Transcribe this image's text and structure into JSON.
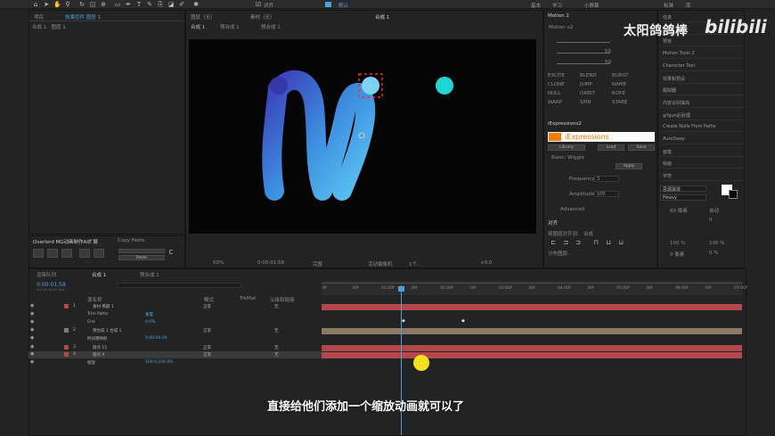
{
  "toolbar": {
    "snap_label": "对齐",
    "active_mode_label": "默认",
    "modes": [
      "基本",
      "学习",
      "小屏幕",
      "标准",
      "库"
    ]
  },
  "project_panel": {
    "tabs": [
      "项目",
      "效果控件 图层 1"
    ],
    "breadcrumb": "合成 1 · 图层 1"
  },
  "viewer": {
    "tabs": [
      "图层（无）",
      "素材（无）",
      "合成 1"
    ],
    "subtabs": [
      "合成 1",
      "预合成 1",
      "预合成 1"
    ],
    "zoom": "50%",
    "timecode": "0:00:01:58",
    "quality": "完整",
    "camera": "活动摄像机",
    "views": "1个...",
    "offset": "+0.0"
  },
  "right_panel": {
    "motion_title": "Motion 2",
    "motion_select": "Motion v2",
    "motion_values": [
      "50",
      "50"
    ],
    "motion_buttons": [
      "EXCITE",
      "BLEND",
      "BURST",
      "CLONE",
      "JUMP",
      "NAME",
      "NULL",
      "ORBIT",
      "ROPE",
      "WARP",
      "SPIN",
      "STARE"
    ],
    "iexp_tab": "iExpressions2",
    "iexp_title": "iExpressions",
    "iexp_buttons": [
      "Library",
      "Load",
      "Save"
    ],
    "iexp_preset": "Basic: Wiggle",
    "apply_label": "Apply",
    "frequency_label": "Frequency",
    "frequency_value": "3",
    "amplitude_label": "Amplitude",
    "amplitude_value": "100",
    "advanced_label": "Advanced",
    "align_title": "对齐",
    "align_to_label": "将图层对齐到:",
    "align_to_value": "合成",
    "distribute_label": "分布图层:",
    "side_items": [
      "信息",
      "音频",
      "预览",
      "Motion Tools 2",
      "Character Tool",
      "效果和预设",
      "跟踪器",
      "内容识别填充",
      "gifgun后处理",
      "Create Nulls From Paths",
      "AutoSway",
      "画笔",
      "绘画",
      "字符"
    ],
    "font_name": "思源黑体",
    "font_style": "Heavy",
    "font_size": "60 像素",
    "leading": "自动",
    "tracking": "0",
    "scale_v": "100 %",
    "scale_h": "100 %",
    "baseline": "0 像素",
    "tsume": "0 %"
  },
  "bottom_left": {
    "tabs": [
      "Overlord MG动画制作AI扩展",
      "Copy Paste"
    ],
    "paste_label": "Paste"
  },
  "timeline": {
    "tabs": [
      "渲染队列",
      "合成 1",
      "预合成 1"
    ],
    "timecode": "0:00:01:58",
    "frame_info": "00118 (60.00 fps)",
    "headers": [
      "源名称",
      "模式",
      "TrkMat",
      "父级和链接"
    ],
    "ruler_ticks": [
      "0f",
      "30f",
      "01:00f",
      "30f",
      "02:00f",
      "30f",
      "03:00f",
      "30f",
      "04:00f",
      "30f",
      "05:00f",
      "30f",
      "06:00f",
      "30f",
      "07:00f"
    ],
    "layers": [
      {
        "num": "1",
        "name": "素材 椭圆 1",
        "mode": "正常",
        "parent": "无"
      },
      {
        "num": "",
        "name": "Trim Paths",
        "mode": "",
        "parent": "重置"
      },
      {
        "num": "",
        "name": "End",
        "mode": "",
        "parent": "0.0%"
      },
      {
        "num": "2",
        "name": "预合成 1 合成 1",
        "mode": "正常",
        "parent": "无"
      },
      {
        "num": "",
        "name": "时间重映射",
        "mode": "",
        "parent": "0:00:00:00"
      },
      {
        "num": "3",
        "name": "圆点 15",
        "mode": "正常",
        "parent": "无"
      },
      {
        "num": "4",
        "name": "圆点 9",
        "mode": "正常",
        "parent": "无"
      },
      {
        "num": "",
        "name": "缩放",
        "mode": "",
        "parent": "100.0,100.0%"
      }
    ]
  },
  "watermark": {
    "text": "太阳鸽鸽棒",
    "logo": "bilibili"
  },
  "subtitle": "直接给他们添加一个缩放动画就可以了",
  "colors": {
    "accent_blue": "#4aa3df",
    "dot_cyan": "#1fd5d5",
    "layer_red": "#b4474b",
    "layer_tan": "#8a7a66",
    "playhead": "#4aa3df",
    "cursor_yellow": "#f5e020"
  }
}
